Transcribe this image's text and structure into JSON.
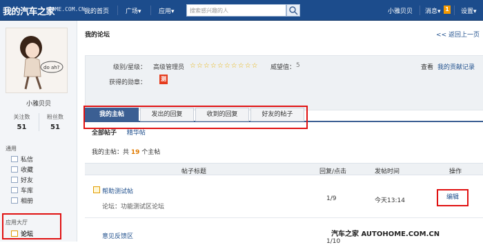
{
  "topbar": {
    "logo": "我的汽车之家",
    "logo_url": "HOME.COM.CN",
    "nav": [
      "我的首页",
      "广场▾",
      "应用▾"
    ],
    "search_placeholder": "搜索感兴趣的人",
    "username": "小雅贝贝",
    "messages": "消息▾",
    "message_count": "1",
    "settings": "设置▾"
  },
  "sidebar": {
    "username": "小雅贝贝",
    "avatar_text": "do ah?",
    "following_label": "关注数",
    "following": "51",
    "fans_label": "粉丝数",
    "fans": "51",
    "section_general": "通用",
    "items": [
      {
        "label": "私信",
        "icon": "mail-icon"
      },
      {
        "label": "收藏",
        "icon": "star-icon"
      },
      {
        "label": "好友",
        "icon": "friends-icon"
      },
      {
        "label": "车库",
        "icon": "car-icon"
      },
      {
        "label": "相册",
        "icon": "album-icon"
      }
    ],
    "section_apps": "应用大厅",
    "app_item": "论坛"
  },
  "main": {
    "title": "我的论坛",
    "back": "<< 返回上一页",
    "level_label": "级别/星级：",
    "level_value": "高级管理员",
    "stars": "☆☆☆☆☆☆☆☆☆☆",
    "prestige_label": "威望值：",
    "prestige_value": "5",
    "contrib_view": "查看",
    "contrib_link": "我的贡献记录",
    "medal_label": "获得的勋章：",
    "medal": "测",
    "tabs": [
      "我的主帖",
      "发出的回复",
      "收到的回复",
      "好友的帖子"
    ],
    "subtabs": [
      "全部帖子",
      "精华帖"
    ],
    "count_prefix": "我的主帖：共",
    "count_value": "19",
    "count_suffix": "个主帖",
    "columns": [
      "帖子标题",
      "回复/点击",
      "发帖时间",
      "操作"
    ],
    "posts": [
      {
        "title": "帮助测试帖",
        "forum": "论坛：功能测试区论坛",
        "stat": "1/9",
        "time": "今天13:14",
        "action": "编辑"
      },
      {
        "title": "意见反馈区",
        "stat": "1/10"
      }
    ]
  },
  "watermark": "汽车之家 AUTOHOME.COM.CN"
}
